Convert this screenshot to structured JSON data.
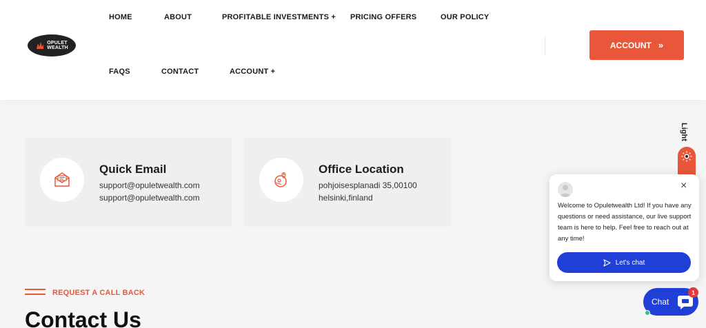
{
  "brand": {
    "logo_text_1": "OPULET",
    "logo_text_2": "WEALTH"
  },
  "nav": {
    "home": "HOME",
    "about": "ABOUT",
    "investments": "PROFITABLE INVESTMENTS +",
    "pricing": "PRICING OFFERS",
    "policy": "OUR POLICY",
    "faqs": "FAQS",
    "contact": "CONTACT",
    "account": "ACCOUNT +"
  },
  "header": {
    "account_button": "ACCOUNT",
    "account_chevron": "»"
  },
  "cards": {
    "email": {
      "title": "Quick Email",
      "line1": "support@opuletwealth.com",
      "line2": "support@opuletwealth.com",
      "icon": "envelope-icon"
    },
    "office": {
      "title": "Office Location",
      "line1": "pohjoisesplanadi 35,00100",
      "line2": "helsinki,finland",
      "icon": "location-icon"
    }
  },
  "theme_toggle": {
    "label": "Light",
    "icon": "sun-icon"
  },
  "chat_popup": {
    "message": "Welcome to Opuletwealth Ltd! If you have any questions or need assistance, our live support team is here to help. Feel free to reach out at any time!",
    "button": "Let's chat",
    "close": "×"
  },
  "chat_launcher": {
    "label": "Chat",
    "badge": "1"
  },
  "callback": {
    "label": "REQUEST A CALL BACK",
    "heading": "Contact Us"
  },
  "colors": {
    "accent": "#e8573a",
    "chat_blue": "#1f3fd6"
  }
}
